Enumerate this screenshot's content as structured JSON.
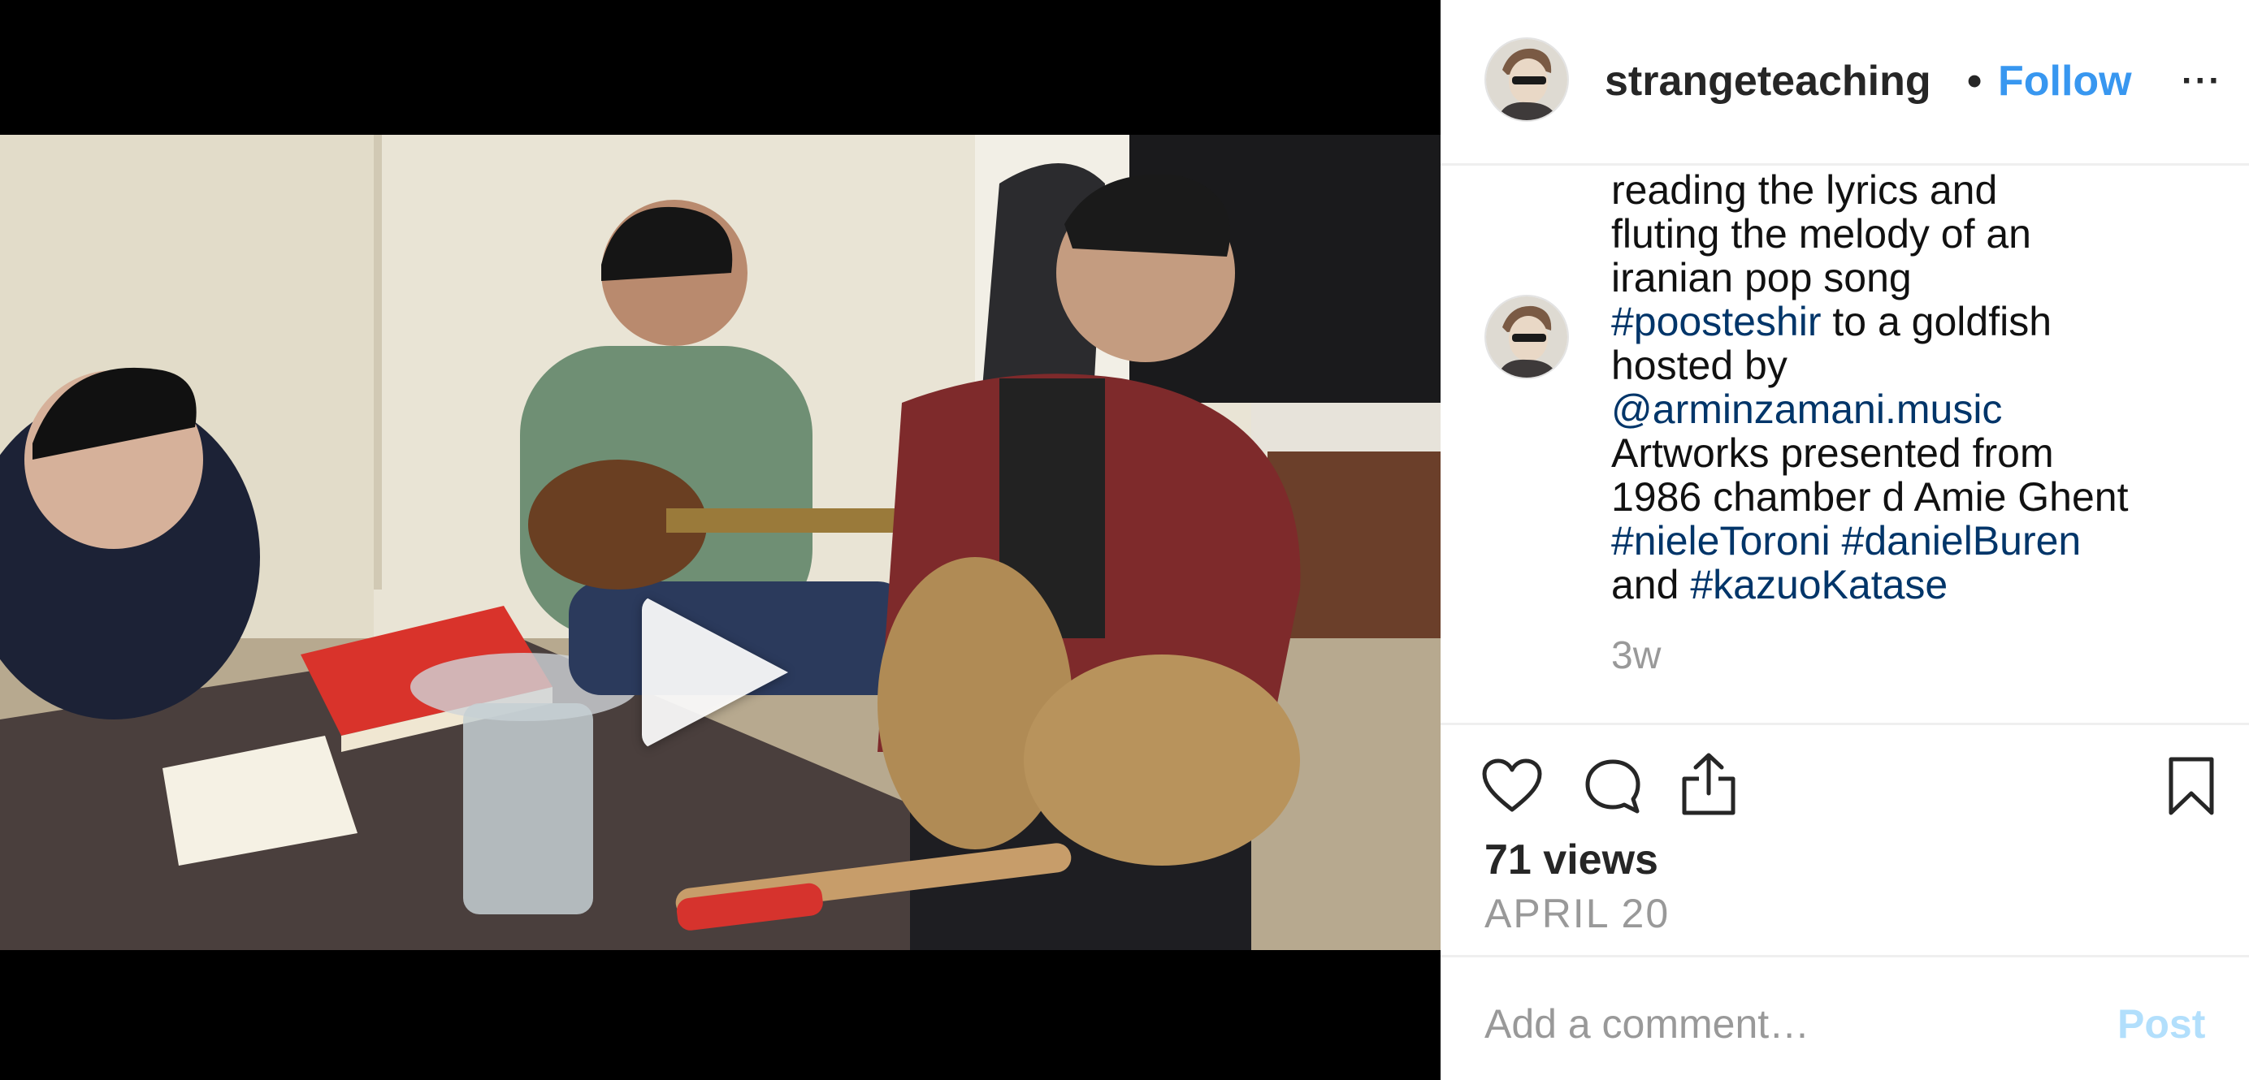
{
  "post": {
    "username": "strangeteaching",
    "separator": "•",
    "follow_label": "Follow",
    "more_label": "···",
    "caption": {
      "line1": "reading the lyrics and",
      "line2": "fluting the melody of an",
      "line3": "iranian pop song",
      "hashtag1": "#poosteshir",
      "line4_rest": " to a goldfish",
      "line5": "hosted by",
      "mention": "@arminzamani.music",
      "line7": "Artworks presented from",
      "line8": "1986 chamber d Amie Ghent",
      "hashtag2": "#nieleToroni",
      "hashtag3": "#danielBuren",
      "line10_prefix": "and ",
      "hashtag4": "#kazuoKatase"
    },
    "time_ago": "3w",
    "views": "71 views",
    "date": "APRIL 20",
    "comment_placeholder": "Add a comment…",
    "post_label": "Post"
  },
  "icons": {
    "play": "play-icon",
    "like": "heart-icon",
    "comment": "comment-bubble-icon",
    "share": "share-icon",
    "save": "bookmark-icon",
    "avatar": "avatar"
  },
  "colors": {
    "link": "#3897f0",
    "tag": "#003569",
    "muted": "#999999",
    "post_disabled": "#b2dffc"
  }
}
